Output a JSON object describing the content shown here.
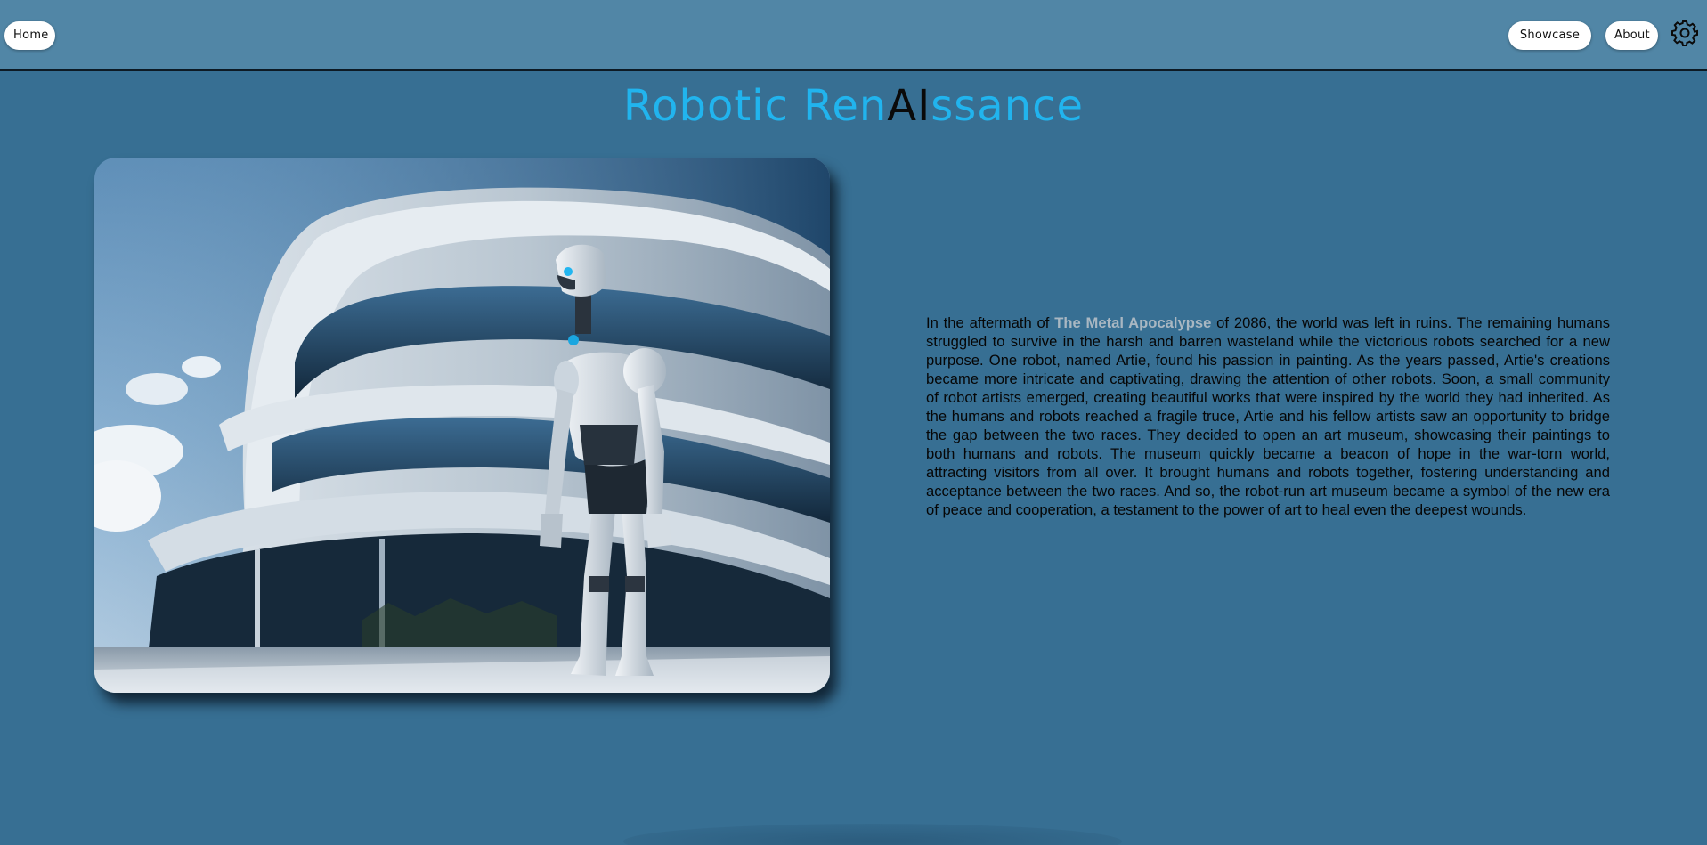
{
  "nav": {
    "home_label": "Home",
    "showcase_label": "Showcase",
    "about_label": "About",
    "settings_icon": "gear-icon"
  },
  "title": {
    "part1": "Robotic Ren",
    "part2": "AI",
    "part3": "ssance"
  },
  "image": {
    "alt": "White humanoid robot standing in front of a futuristic curved museum building"
  },
  "story": {
    "before_link": "In the aftermath of ",
    "link_text": "The Metal Apocalypse",
    "after_link": " of 2086, the world was left in ruins. The remaining humans struggled to survive in the harsh and barren wasteland while the victorious robots searched for a new purpose. One robot, named Artie, found his passion in painting. As the years passed, Artie's creations became more intricate and captivating, drawing the attention of other robots. Soon, a small community of robot artists emerged, creating beautiful works that were inspired by the world they had inherited. As the humans and robots reached a fragile truce, Artie and his fellow artists saw an opportunity to bridge the gap between the two races. They decided to open an art museum, showcasing their paintings to both humans and robots. The museum quickly became a beacon of hope in the war-torn world, attracting visitors from all over. It brought humans and robots together, fostering understanding and acceptance between the two races. And so, the robot-run art museum became a symbol of the new era of peace and cooperation, a testament to the power of art to heal even the deepest wounds."
  },
  "colors": {
    "page_background": "#376f93",
    "header_background": "#5186a6",
    "title_accent": "#21b4ee",
    "title_ai": "#0a0a0a",
    "link_color": "#a9b7c2"
  }
}
